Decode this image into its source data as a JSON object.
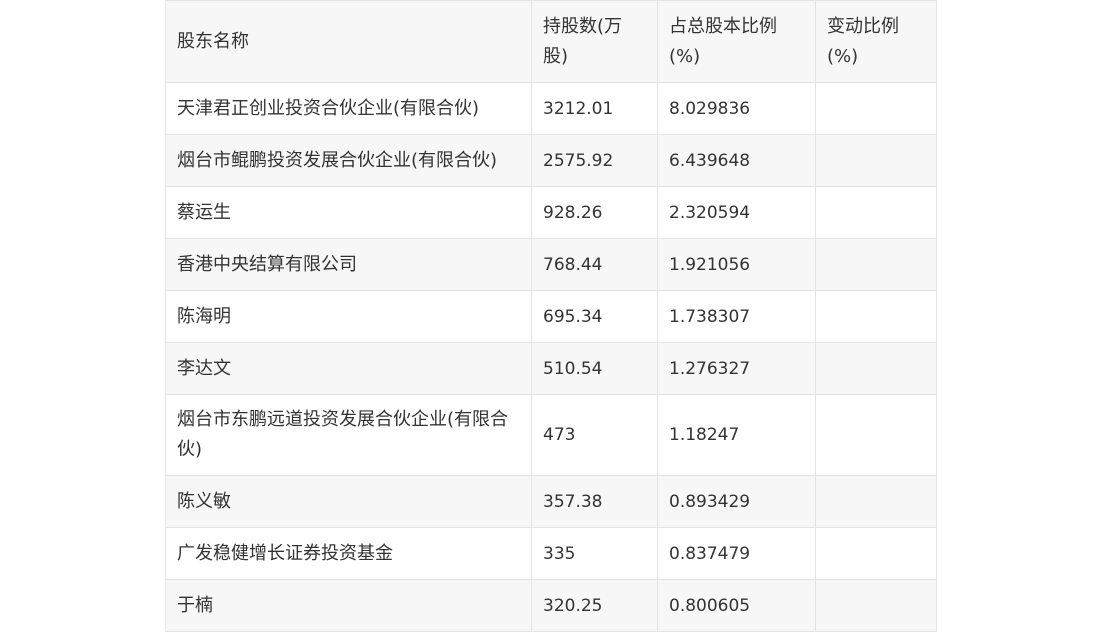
{
  "table": {
    "headers": [
      "股东名称",
      "持股数(万股)",
      "占总股本比例(%)",
      "变动比例(%)"
    ],
    "rows": [
      {
        "name": "天津君正创业投资合伙企业(有限合伙)",
        "shares": "3212.01",
        "ratio": "8.029836",
        "change": ""
      },
      {
        "name": "烟台市鲲鹏投资发展合伙企业(有限合伙)",
        "shares": "2575.92",
        "ratio": "6.439648",
        "change": ""
      },
      {
        "name": "蔡运生",
        "shares": "928.26",
        "ratio": "2.320594",
        "change": ""
      },
      {
        "name": "香港中央结算有限公司",
        "shares": "768.44",
        "ratio": "1.921056",
        "change": ""
      },
      {
        "name": "陈海明",
        "shares": "695.34",
        "ratio": "1.738307",
        "change": ""
      },
      {
        "name": "李达文",
        "shares": "510.54",
        "ratio": "1.276327",
        "change": ""
      },
      {
        "name": "烟台市东鹏远道投资发展合伙企业(有限合伙)",
        "shares": "473",
        "ratio": "1.18247",
        "change": ""
      },
      {
        "name": "陈义敏",
        "shares": "357.38",
        "ratio": "0.893429",
        "change": ""
      },
      {
        "name": "广发稳健增长证券投资基金",
        "shares": "335",
        "ratio": "0.837479",
        "change": ""
      },
      {
        "name": "于楠",
        "shares": "320.25",
        "ratio": "0.800605",
        "change": ""
      }
    ]
  }
}
